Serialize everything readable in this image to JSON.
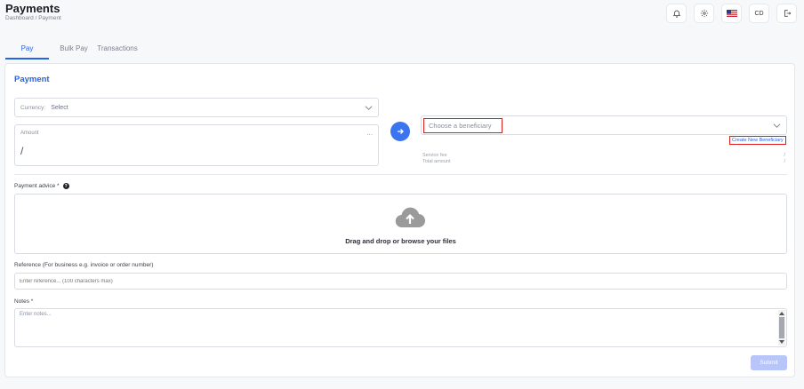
{
  "header": {
    "title": "Payments",
    "breadcrumb": "Dashboard / Payment"
  },
  "topbar": {
    "icons": [
      "bell-icon",
      "gear-icon",
      "us-flag-icon",
      "avatar",
      "logout-icon"
    ],
    "avatar_initials": "CD"
  },
  "tabs": [
    "Pay",
    "Bulk Pay",
    "Transactions"
  ],
  "form": {
    "title": "Payment",
    "currency": {
      "label": "Currency:",
      "value": "Select"
    },
    "amount": {
      "label": "Amount",
      "dots": "...",
      "value": "/"
    },
    "beneficiary_placeholder": "Choose a beneficiary",
    "create_beneficiary": "Create New Beneficiary",
    "service_fee_label": "Service fee",
    "service_fee_value": "/",
    "total_amount_label": "Total amount",
    "total_amount_value": "/",
    "payment_advice_label": "Payment advice *",
    "help_glyph": "?",
    "dropzone_text": "Drag and drop or browse your files",
    "reference_label": "Reference (For business e.g. invoice or order number)",
    "reference_placeholder": "Enter reference... (100 characters max)",
    "notes_label": "Notes *",
    "notes_placeholder": "Enter notes...",
    "submit_label": "Submit"
  },
  "colors": {
    "accent": "#2563eb",
    "highlight": "#e01b1b",
    "submit_disabled": "#b7c5f8"
  }
}
